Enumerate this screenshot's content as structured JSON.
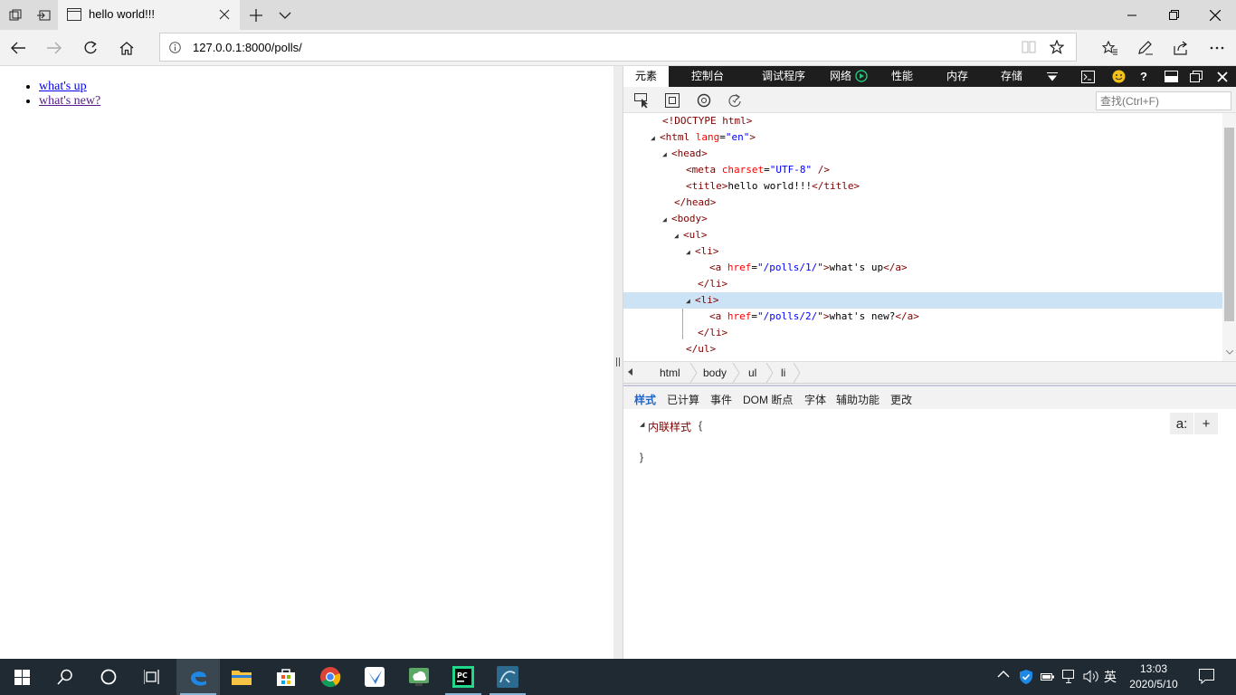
{
  "browser": {
    "tab_title": "hello world!!!",
    "address": "127.0.0.1:8000/polls/"
  },
  "page": {
    "links": [
      "what's up",
      "what's new?"
    ]
  },
  "devtools": {
    "tabs": [
      "元素",
      "控制台",
      "调试程序",
      "网络",
      "性能",
      "内存",
      "存储"
    ],
    "find_placeholder": "查找(Ctrl+F)",
    "dom": {
      "doctype": "<!DOCTYPE html>",
      "html_open": "<html",
      "lang_attr": "lang",
      "lang_val": "\"en\"",
      "head_open": "<head>",
      "meta_open": "<meta",
      "charset_attr": "charset",
      "charset_val": "\"UTF-8\"",
      "meta_close": " />",
      "title_open": "<title>",
      "title_text": "hello world!!!",
      "title_close": "</title>",
      "head_close": "</head>",
      "body_open": "<body>",
      "ul_open": "<ul>",
      "li_open": "<li>",
      "a_open": "<a",
      "href_attr": "href",
      "href1": "\"/polls/1/\"",
      "a1_text": "what's up",
      "a_close": "</a>",
      "li_close": "</li>",
      "href2": "\"/polls/2/\"",
      "a2_text": "what's new?",
      "ul_close": "</ul>",
      "gt": ">",
      "eq": "="
    },
    "breadcrumbs": [
      "html",
      "body",
      "ul",
      "li"
    ],
    "style_tabs": [
      "样式",
      "已计算",
      "事件",
      "DOM 断点",
      "字体",
      "辅助功能",
      "更改"
    ],
    "inline_style_label": "内联样式",
    "brace_open": "{",
    "brace_close": "}",
    "aa_button": "a:",
    "add_button": "+"
  },
  "taskbar": {
    "time": "13:03",
    "date": "2020/5/10",
    "ime": "英"
  },
  "colors": {
    "link": "#0000ee",
    "visited": "#551a8b",
    "selection": "#cce2f5",
    "tag": "#800000",
    "attr": "#ff0000",
    "value": "#0000ff"
  }
}
